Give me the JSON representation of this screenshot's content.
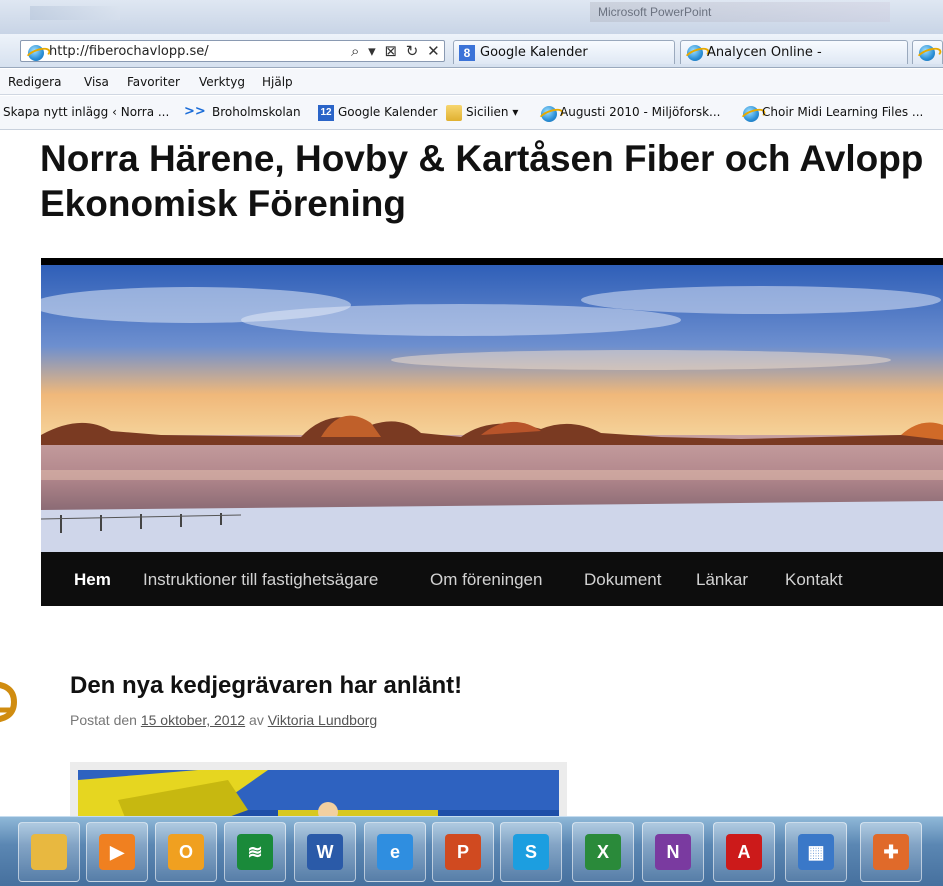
{
  "browser": {
    "window_title": "Microsoft PowerPoint",
    "address_url": "http://fiberochavlopp.se/",
    "address_controls": "⌕ ▾ ⊠ ↻ ✕",
    "tabs": [
      {
        "label": "Google Kalender",
        "icon": "google-calendar-icon"
      },
      {
        "label": "Analycen Online -",
        "icon": "ie-page-icon"
      }
    ],
    "menu": [
      "Redigera",
      "Visa",
      "Favoriter",
      "Verktyg",
      "Hjälp"
    ],
    "favorites": [
      {
        "label": "Skapa nytt inlägg ‹ Norra ...",
        "icon": "none"
      },
      {
        "label": "Broholmskolan",
        "icon": "double-chevron-icon"
      },
      {
        "label": "Google Kalender",
        "icon": "calendar-12-icon",
        "badge": "12"
      },
      {
        "label": "Sicilien ▾",
        "icon": "folder-icon"
      },
      {
        "label": "Augusti 2010 - Miljöforsk...",
        "icon": "ie-page-icon"
      },
      {
        "label": "Choir Midi Learning Files ...",
        "icon": "ie-page-icon"
      }
    ]
  },
  "site": {
    "title": "Norra Härene, Hovby & Kartåsen Fiber och Avlopp Ekonomisk Förening",
    "nav": [
      "Hem",
      "Instruktioner till fastighetsägare",
      "Om föreningen",
      "Dokument",
      "Länkar",
      "Kontakt"
    ],
    "active_nav": "Hem"
  },
  "post": {
    "title": "Den nya kedjegrävaren har anlänt!",
    "meta_prefix": "Postat den",
    "date": "15 oktober, 2012",
    "meta_by": "av",
    "author": "Viktoria Lundborg"
  },
  "taskbar": [
    {
      "icon": "file-explorer-icon",
      "color": "#e8b840"
    },
    {
      "icon": "media-player-icon",
      "color": "#f08020",
      "glyph": "▶"
    },
    {
      "icon": "outlook-icon",
      "color": "#f0a020",
      "glyph": "O"
    },
    {
      "icon": "spotify-icon",
      "color": "#1a8a3a",
      "glyph": "≋"
    },
    {
      "icon": "word-icon",
      "color": "#2a5aa8",
      "glyph": "W"
    },
    {
      "icon": "internet-explorer-icon",
      "color": "#2f8ee0",
      "glyph": "e"
    },
    {
      "icon": "powerpoint-icon",
      "color": "#d04a20",
      "glyph": "P"
    },
    {
      "icon": "skype-icon",
      "color": "#1c9ee0",
      "glyph": "S"
    },
    {
      "icon": "excel-icon",
      "color": "#2a8a3a",
      "glyph": "X"
    },
    {
      "icon": "onenote-icon",
      "color": "#7a3aa0",
      "glyph": "N"
    },
    {
      "icon": "acrobat-icon",
      "color": "#cc1a1a",
      "glyph": "A"
    },
    {
      "icon": "remote-desktop-icon",
      "color": "#3a78c8",
      "glyph": "▦"
    },
    {
      "icon": "windows-app-icon",
      "color": "#e06a2a",
      "glyph": "✚"
    }
  ]
}
